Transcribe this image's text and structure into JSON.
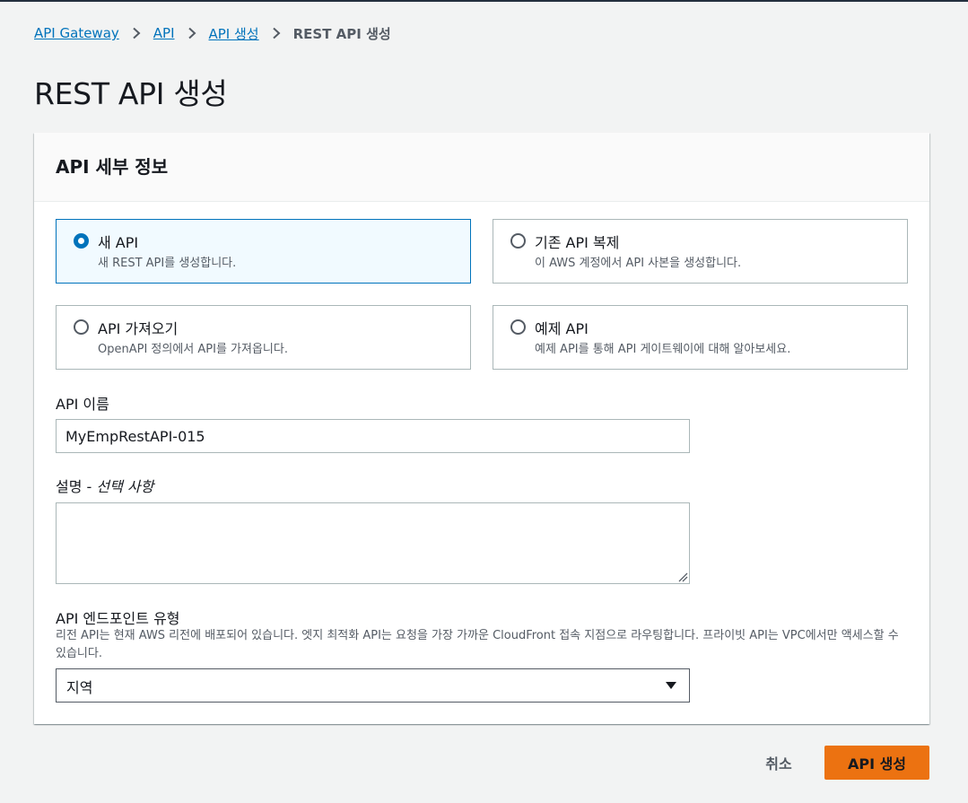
{
  "breadcrumb": {
    "items": [
      "API Gateway",
      "API",
      "API 생성"
    ],
    "current": "REST API 생성"
  },
  "page": {
    "title": "REST API 생성"
  },
  "panel": {
    "title": "API 세부 정보",
    "options": [
      {
        "label": "새 API",
        "description": "새 REST API를 생성합니다.",
        "selected": true
      },
      {
        "label": "기존 API 복제",
        "description": "이 AWS 계정에서 API 사본을 생성합니다.",
        "selected": false
      },
      {
        "label": "API 가져오기",
        "description": "OpenAPI 정의에서 API를 가져옵니다.",
        "selected": false
      },
      {
        "label": "예제 API",
        "description": "예제 API를 통해 API 게이트웨이에 대해 알아보세요.",
        "selected": false
      }
    ],
    "api_name": {
      "label": "API 이름",
      "value": "MyEmpRestAPI-015"
    },
    "description": {
      "label": "설명 - ",
      "optional": "선택 사항",
      "value": ""
    },
    "endpoint_type": {
      "label": "API 엔드포인트 유형",
      "description": "리전 API는 현재 AWS 리전에 배포되어 있습니다. 엣지 최적화 API는 요청을 가장 가까운 CloudFront 접속 지점으로 라우팅합니다. 프라이빗 API는 VPC에서만 액세스할 수 있습니다.",
      "selected": "지역"
    }
  },
  "actions": {
    "cancel": "취소",
    "create": "API 생성"
  },
  "colors": {
    "link": "#0073bb",
    "primary": "#ec7211",
    "selected_border": "#0073bb",
    "selected_bg": "#f1faff"
  },
  "icons": [
    "chevron-right-icon",
    "radio-icon",
    "caret-down-icon",
    "resize-grip-icon"
  ]
}
